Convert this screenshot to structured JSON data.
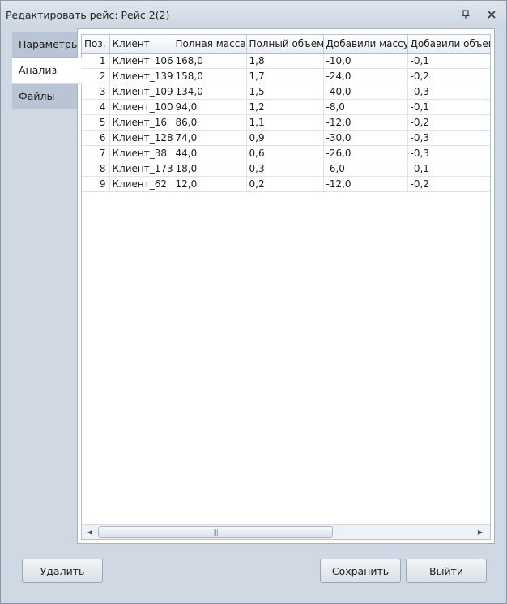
{
  "window": {
    "title": "Редактировать рейс: Рейс 2(2)",
    "pin_icon": "pin-icon",
    "close_icon": "close-icon"
  },
  "tabs": [
    {
      "label": "Параметры",
      "active": false
    },
    {
      "label": "Анализ",
      "active": true
    },
    {
      "label": "Файлы",
      "active": false
    }
  ],
  "grid": {
    "columns": [
      "Поз.",
      "Клиент",
      "Полная масса",
      "Полный объем",
      "Добавили массу",
      "Добавили объем"
    ],
    "rows": [
      [
        "1",
        "Клиент_106",
        "168,0",
        "1,8",
        "-10,0",
        "-0,1"
      ],
      [
        "2",
        "Клиент_139",
        "158,0",
        "1,7",
        "-24,0",
        "-0,2"
      ],
      [
        "3",
        "Клиент_109",
        "134,0",
        "1,5",
        "-40,0",
        "-0,3"
      ],
      [
        "4",
        "Клиент_100",
        "94,0",
        "1,2",
        "-8,0",
        "-0,1"
      ],
      [
        "5",
        "Клиент_16",
        "86,0",
        "1,1",
        "-12,0",
        "-0,2"
      ],
      [
        "6",
        "Клиент_128",
        "74,0",
        "0,9",
        "-30,0",
        "-0,3"
      ],
      [
        "7",
        "Клиент_38",
        "44,0",
        "0,6",
        "-26,0",
        "-0,3"
      ],
      [
        "8",
        "Клиент_173",
        "18,0",
        "0,3",
        "-6,0",
        "-0,1"
      ],
      [
        "9",
        "Клиент_62",
        "12,0",
        "0,2",
        "-12,0",
        "-0,2"
      ]
    ]
  },
  "buttons": {
    "delete": "Удалить",
    "save": "Сохранить",
    "exit": "Выйти"
  },
  "colors": {
    "window_bg": "#cfd8e3",
    "tab_bg": "#b9c5d4",
    "grid_bg": "#ffffff"
  }
}
